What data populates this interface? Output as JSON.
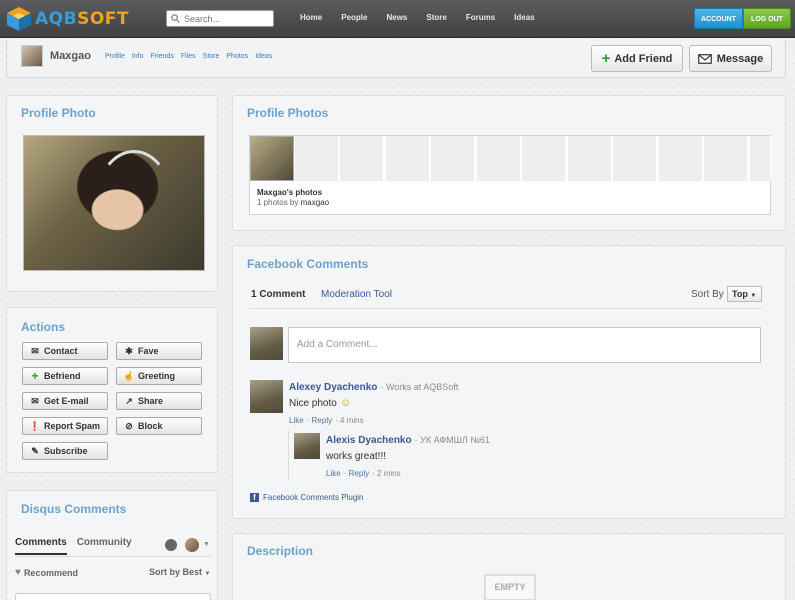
{
  "topbar": {
    "logo_a": "AQB",
    "logo_b": "SOFT",
    "search_placeholder": "Search...",
    "nav": [
      "Home",
      "People",
      "News",
      "Store",
      "Forums",
      "Ideas"
    ],
    "account_label": "ACCOUNT",
    "logout_label": "LOG OUT"
  },
  "profile": {
    "name": "Maxgao",
    "links": [
      "Profile",
      "Info",
      "Friends",
      "Files",
      "Store",
      "Photos",
      "Ideas"
    ],
    "add_friend_label": "Add Friend",
    "message_label": "Message"
  },
  "profile_photo": {
    "title": "Profile Photo"
  },
  "actions": {
    "title": "Actions",
    "buttons": [
      {
        "label": "Contact",
        "icon": "envelope-icon"
      },
      {
        "label": "Fave",
        "icon": "star-icon"
      },
      {
        "label": "Befriend",
        "icon": "plus-icon"
      },
      {
        "label": "Greeting",
        "icon": "thumbs-up-icon"
      },
      {
        "label": "Get E-mail",
        "icon": "mail-icon"
      },
      {
        "label": "Share",
        "icon": "share-icon"
      },
      {
        "label": "Report Spam",
        "icon": "alert-icon"
      },
      {
        "label": "Block",
        "icon": "block-icon"
      },
      {
        "label": "Subscribe",
        "icon": "subscribe-icon"
      }
    ]
  },
  "disqus": {
    "title": "Disqus Comments",
    "tabs": [
      "Comments",
      "Community"
    ],
    "recommend_label": "Recommend",
    "sort_label": "Sort by Best"
  },
  "profile_photos": {
    "title": "Profile Photos",
    "album_title": "Maxgao's photos",
    "album_meta_prefix": "1 photos by ",
    "album_meta_user": "maxgao"
  },
  "facebook": {
    "title": "Facebook Comments",
    "count_label": "1 Comment",
    "moderation_label": "Moderation Tool",
    "sort_label": "Sort By",
    "sort_value": "Top",
    "input_placeholder": "Add a Comment...",
    "comments": [
      {
        "name": "Alexey Dyachenko",
        "meta": "Works at AQBSoft",
        "text": "Nice photo",
        "like": "Like",
        "reply": "Reply",
        "time": "4 mins"
      },
      {
        "name": "Alexis Dyachenko",
        "meta": "УК АФМШЛ №61",
        "text": "works great!!!",
        "like": "Like",
        "reply": "Reply",
        "time": "2 mins"
      }
    ],
    "plugin_label": "Facebook Comments Plugin"
  },
  "description": {
    "title": "Description",
    "empty_label": "EMPTY"
  }
}
